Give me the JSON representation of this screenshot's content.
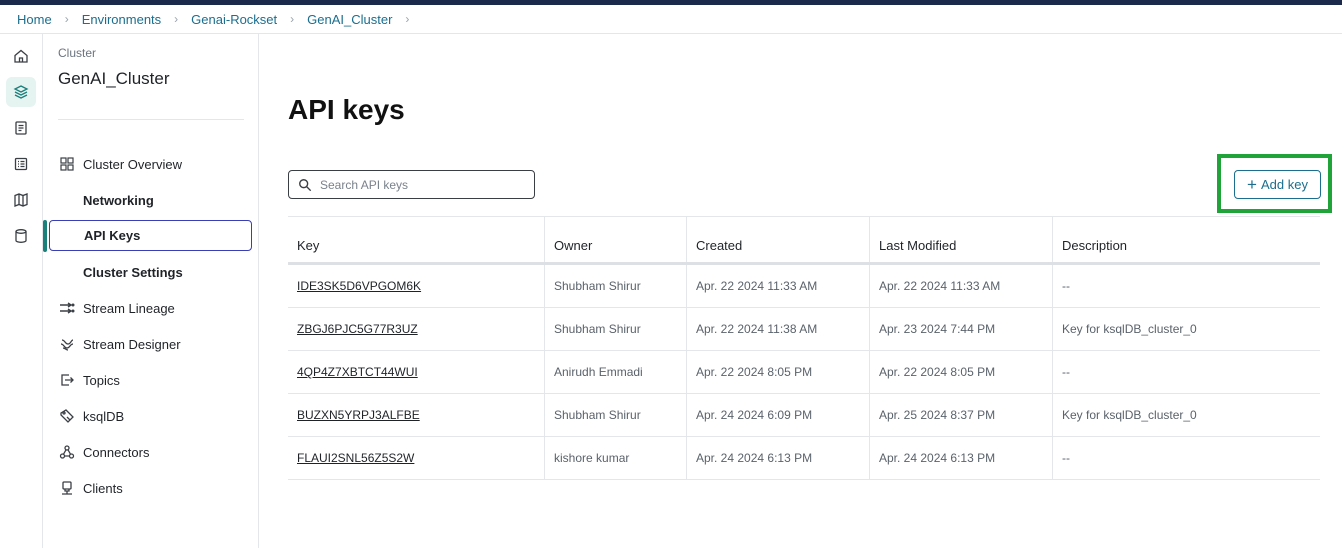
{
  "breadcrumb": [
    "Home",
    "Environments",
    "Genai-Rockset",
    "GenAI_Cluster"
  ],
  "rail": [
    {
      "icon": "home-icon"
    },
    {
      "icon": "layers-icon",
      "active": true
    },
    {
      "icon": "document-icon"
    },
    {
      "icon": "list-icon"
    },
    {
      "icon": "map-icon"
    },
    {
      "icon": "database-icon"
    }
  ],
  "sidebar": {
    "caption": "Cluster",
    "title": "GenAI_Cluster",
    "items": [
      {
        "label": "Cluster Overview",
        "icon": "grid-icon"
      },
      {
        "label": "Networking"
      },
      {
        "label": "API Keys",
        "active": true
      },
      {
        "label": "Cluster Settings"
      },
      {
        "label": "Stream Lineage",
        "icon": "lineage-icon"
      },
      {
        "label": "Stream Designer",
        "icon": "designer-icon"
      },
      {
        "label": "Topics",
        "icon": "topics-icon"
      },
      {
        "label": "ksqlDB",
        "icon": "ksqldb-icon"
      },
      {
        "label": "Connectors",
        "icon": "connectors-icon"
      },
      {
        "label": "Clients",
        "icon": "clients-icon"
      }
    ]
  },
  "main": {
    "title": "API keys",
    "search_placeholder": "Search API keys",
    "add_button": "Add key"
  },
  "table": {
    "columns": [
      "Key",
      "Owner",
      "Created",
      "Last Modified",
      "Description"
    ],
    "rows": [
      [
        "IDE3SK5D6VPGOM6K",
        "Shubham Shirur",
        "Apr. 22 2024 11:33 AM",
        "Apr. 22 2024 11:33 AM",
        "--"
      ],
      [
        "ZBGJ6PJC5G77R3UZ",
        "Shubham Shirur",
        "Apr. 22 2024 11:38 AM",
        "Apr. 23 2024 7:44 PM",
        "Key for ksqlDB_cluster_0"
      ],
      [
        "4QP4Z7XBTCT44WUI",
        "Anirudh Emmadi",
        "Apr. 22 2024 8:05 PM",
        "Apr. 22 2024 8:05 PM",
        "--"
      ],
      [
        "BUZXN5YRPJ3ALFBE",
        "Shubham Shirur",
        "Apr. 24 2024 6:09 PM",
        "Apr. 25 2024 8:37 PM",
        "Key for ksqlDB_cluster_0"
      ],
      [
        "FLAUI2SNL56Z5S2W",
        "kishore kumar",
        "Apr. 24 2024 6:13 PM",
        "Apr. 24 2024 6:13 PM",
        "--"
      ]
    ]
  },
  "colors": {
    "accent": "#1b6e8f",
    "highlight": "#20a43a",
    "topbar": "#1b2a4a"
  }
}
